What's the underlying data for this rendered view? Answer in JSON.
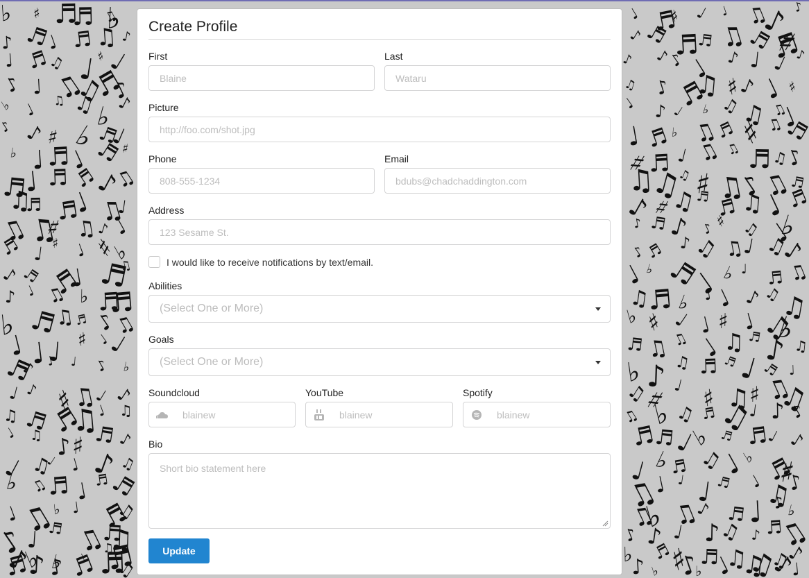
{
  "page": {
    "accent_color": "#2185d0",
    "background_color": "#c9c9c9",
    "top_line_color": "#6f6cb3"
  },
  "form": {
    "title": "Create Profile",
    "first": {
      "label": "First",
      "placeholder": "Blaine"
    },
    "last": {
      "label": "Last",
      "placeholder": "Wataru"
    },
    "picture": {
      "label": "Picture",
      "placeholder": "http://foo.com/shot.jpg"
    },
    "phone": {
      "label": "Phone",
      "placeholder": "808-555-1234"
    },
    "email": {
      "label": "Email",
      "placeholder": "bdubs@chadchaddington.com"
    },
    "address": {
      "label": "Address",
      "placeholder": "123 Sesame St."
    },
    "notifications": {
      "label": "I would like to receive notifications by text/email.",
      "checked": false
    },
    "abilities": {
      "label": "Abilities",
      "placeholder": "(Select One or More)"
    },
    "goals": {
      "label": "Goals",
      "placeholder": "(Select One or More)"
    },
    "soundcloud": {
      "label": "Soundcloud",
      "placeholder": "blainew",
      "icon": "soundcloud-icon"
    },
    "youtube": {
      "label": "YouTube",
      "placeholder": "blainew",
      "icon": "youtube-icon"
    },
    "spotify": {
      "label": "Spotify",
      "placeholder": "blainew",
      "icon": "spotify-icon"
    },
    "bio": {
      "label": "Bio",
      "placeholder": "Short bio statement here"
    },
    "submit_label": "Update"
  }
}
